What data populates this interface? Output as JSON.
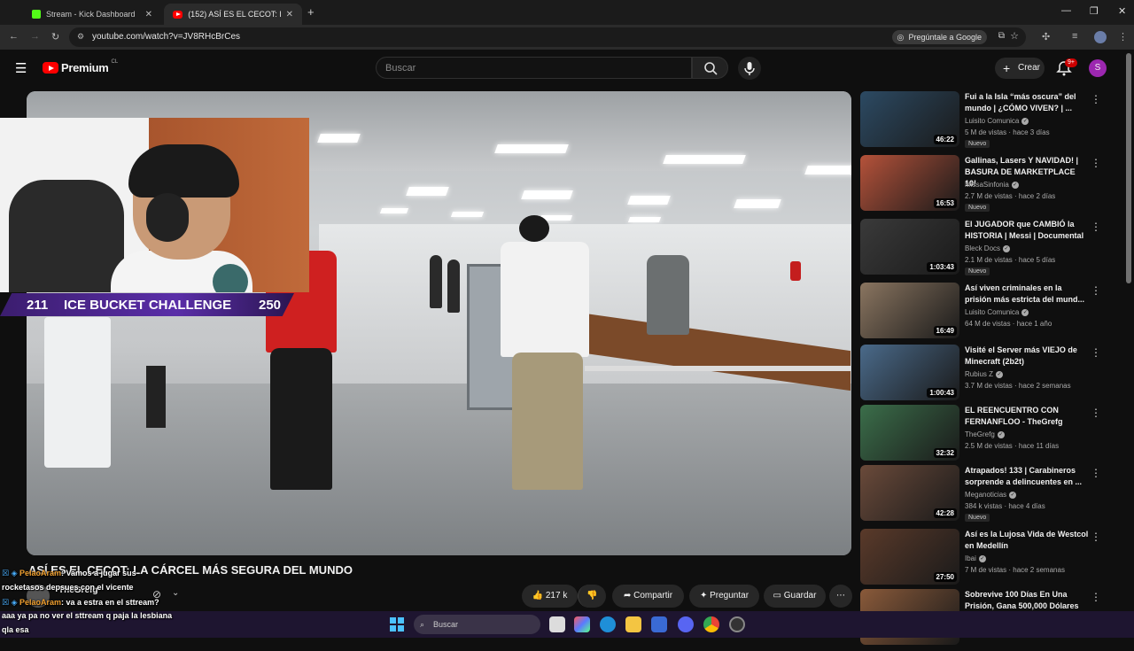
{
  "browser": {
    "tabs": [
      {
        "title": "Stream - Kick Dashboard",
        "active": false
      },
      {
        "title": "(152) ASÍ ES EL CECOT: LA CÁRC",
        "active": true
      }
    ],
    "new_tab_icon": "plus-icon",
    "url": "youtube.com/watch?v=JV8RHcBrCes",
    "ask_google": "Pregúntale a Google"
  },
  "youtube": {
    "logo_text": "Premium",
    "logo_region": "CL",
    "search_placeholder": "Buscar",
    "create_label": "Crear",
    "notifications_badge": "9+",
    "avatar_letter": "S"
  },
  "stream_overlay": {
    "goal_current": "211",
    "goal_label": "ICE BUCKET CHALLENGE",
    "goal_target": "250"
  },
  "video": {
    "title": "ASÍ ES EL CECOT: LA CÁRCEL MÁS SEGURA DEL MUNDO",
    "channel": "TheGrefg",
    "likes": "217 k",
    "share_label": "Compartir",
    "ask_label": "Preguntar",
    "save_label": "Guardar"
  },
  "chat": [
    {
      "name": "PelaoAram",
      "text": ": Vamos a jugar sus"
    },
    {
      "name": "",
      "text": "rocketasos depsues con el vicente"
    },
    {
      "name": "PelaoAram",
      "text": ": va a estra en el sttream?"
    },
    {
      "name": "",
      "text": "aaa ya pa no ver el sttream q paja la lesbiana"
    },
    {
      "name": "",
      "text": "qla esa"
    }
  ],
  "recommendations": [
    {
      "title": "Fui a la Isla “más oscura” del mundo | ¿CÓMO VIVEN? | ...",
      "channel": "Luisito Comunica",
      "meta": "5 M de vistas · hace 3 días",
      "duration": "46:22",
      "badge": "Nuevo",
      "thumb_color": "#2c4a63"
    },
    {
      "title": "Gallinas, Lasers Y NAVIDAD! | BASURA DE MARKETPLACE 10!",
      "channel": "MissaSinfonia",
      "meta": "2.7 M de vistas · hace 2 días",
      "duration": "16:53",
      "badge": "Nuevo",
      "thumb_color": "#b5523a"
    },
    {
      "title": "El JUGADOR que CAMBIÓ la HISTORIA | Messi | Documental",
      "channel": "Bleck Docs",
      "meta": "2.1 M de vistas · hace 5 días",
      "duration": "1:03:43",
      "badge": "Nuevo",
      "thumb_color": "#3a3a3a"
    },
    {
      "title": "Así viven criminales en la prisión más estricta del mund...",
      "channel": "Luisito Comunica",
      "meta": "64 M de vistas · hace 1 año",
      "duration": "16:49",
      "badge": "",
      "thumb_color": "#8a7560"
    },
    {
      "title": "Visité el Server más VIEJO de Minecraft (2b2t)",
      "channel": "Rubius Z",
      "meta": "3.7 M de vistas · hace 2 semanas",
      "duration": "1:00:43",
      "badge": "",
      "thumb_color": "#4a6a8a"
    },
    {
      "title": "EL REENCUENTRO CON FERNANFLOO - TheGrefg",
      "channel": "TheGrefg",
      "meta": "2.5 M de vistas · hace 11 días",
      "duration": "32:32",
      "badge": "",
      "thumb_color": "#3b6e4a"
    },
    {
      "title": "Atrapados! 133 | Carabineros sorprende a delincuentes en ...",
      "channel": "Meganoticias",
      "meta": "384 k vistas · hace 4 días",
      "duration": "42:28",
      "badge": "Nuevo",
      "thumb_color": "#6a4a3a"
    },
    {
      "title": "Así es la Lujosa Vida de Westcol en Medellín",
      "channel": "Ibai",
      "meta": "7 M de vistas · hace 2 semanas",
      "duration": "27:50",
      "badge": "",
      "thumb_color": "#5a3a2a"
    },
    {
      "title": "Sobrevive 100 Días En Una Prisión, Gana 500,000 Dólares",
      "channel": "",
      "meta": "",
      "duration": "",
      "badge": "",
      "thumb_color": "#8a5a3a"
    }
  ],
  "taskbar": {
    "search_placeholder": "Buscar"
  }
}
